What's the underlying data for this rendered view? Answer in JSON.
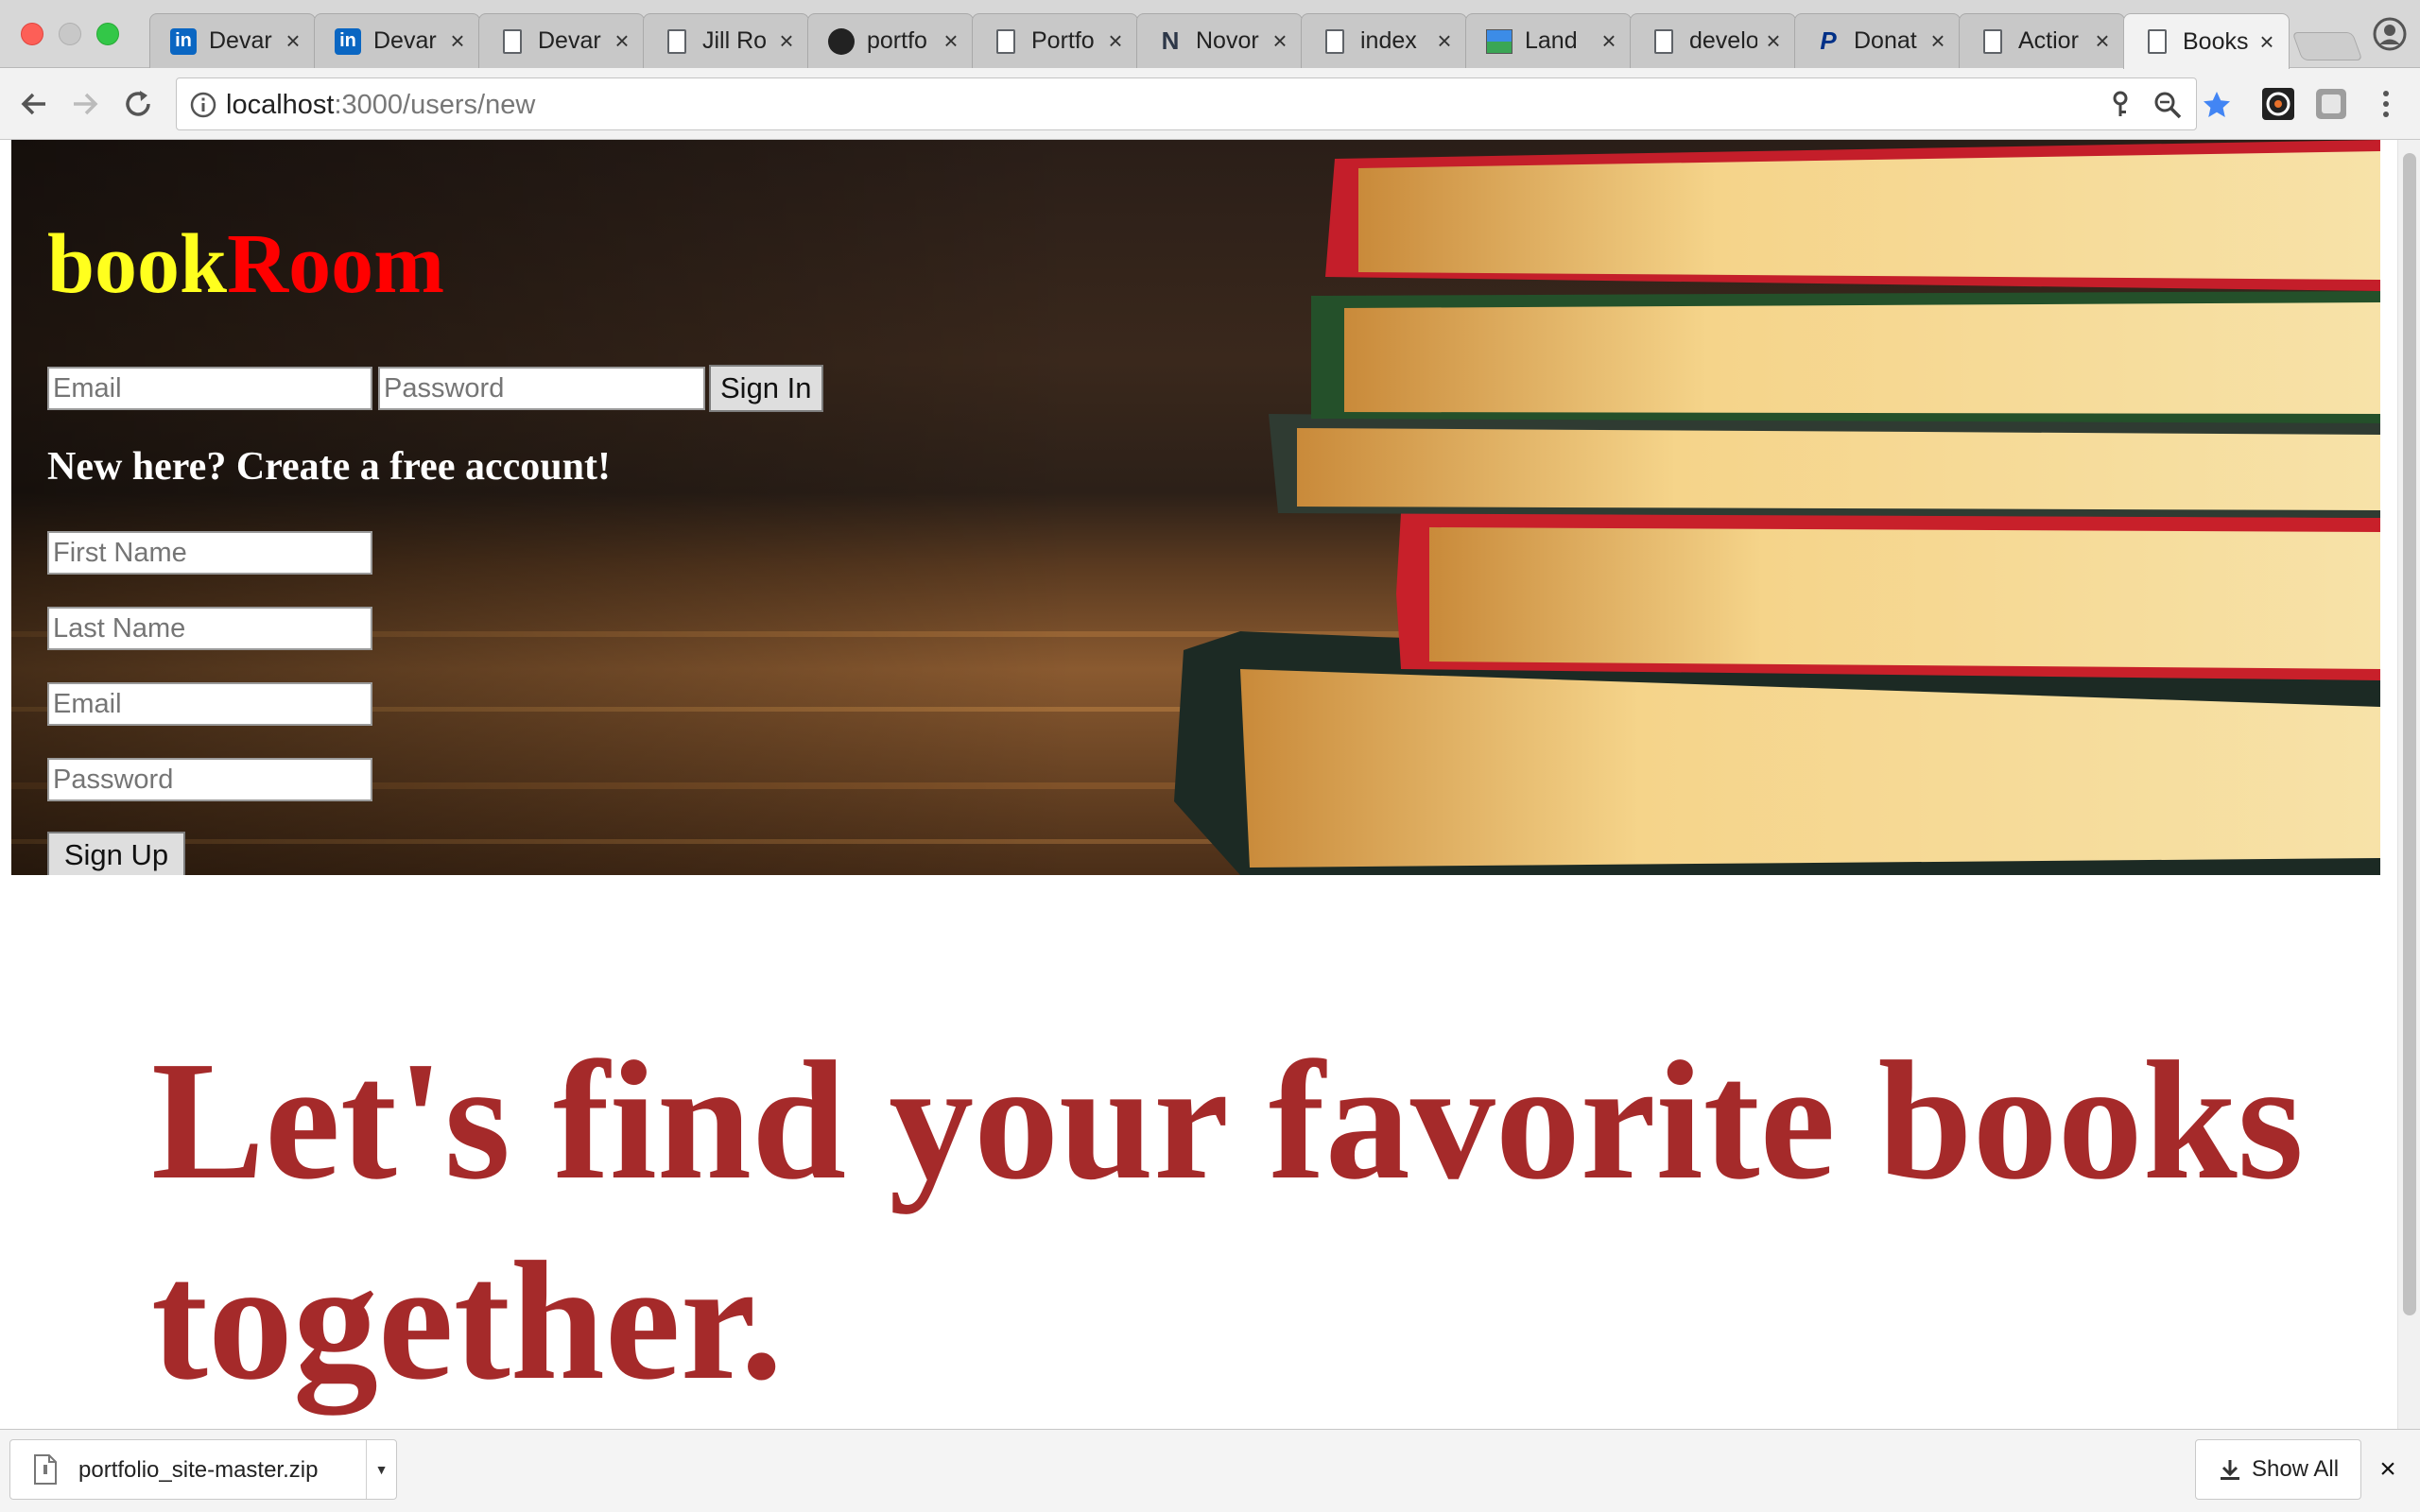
{
  "browser": {
    "tabs": [
      {
        "title": "Devar",
        "icon": "linkedin-icon"
      },
      {
        "title": "Devar",
        "icon": "linkedin-icon"
      },
      {
        "title": "Devar",
        "icon": "page-icon"
      },
      {
        "title": "Jill Ro",
        "icon": "page-icon"
      },
      {
        "title": "portfo",
        "icon": "github-icon"
      },
      {
        "title": "Portfo",
        "icon": "page-icon"
      },
      {
        "title": "Novor",
        "icon": "n-logo-icon"
      },
      {
        "title": "index",
        "icon": "page-icon"
      },
      {
        "title": "Land",
        "icon": "landscape-icon"
      },
      {
        "title": "develo",
        "icon": "page-icon"
      },
      {
        "title": "Donat",
        "icon": "paypal-icon"
      },
      {
        "title": "Actior",
        "icon": "page-icon"
      },
      {
        "title": "Books",
        "icon": "page-icon",
        "active": true
      }
    ],
    "url_host": "localhost",
    "url_path": ":3000/users/new"
  },
  "page": {
    "brand_part1": "book",
    "brand_part2": "Room",
    "signin": {
      "email_placeholder": "Email",
      "password_placeholder": "Password",
      "button_label": "Sign In"
    },
    "signup": {
      "heading": "New here? Create a free account!",
      "first_name_placeholder": "First Name",
      "last_name_placeholder": "Last Name",
      "email_placeholder": "Email",
      "password_placeholder": "Password",
      "button_label": "Sign Up"
    },
    "headline": "Let's find your favorite books together."
  },
  "downloads": {
    "file_name": "portfolio_site-master.zip",
    "show_all_label": "Show All"
  },
  "colors": {
    "brand_yellow": "#ffff1e",
    "brand_red": "#ff0000",
    "headline": "#a52a2a",
    "bookmark_star": "#4285f4"
  }
}
